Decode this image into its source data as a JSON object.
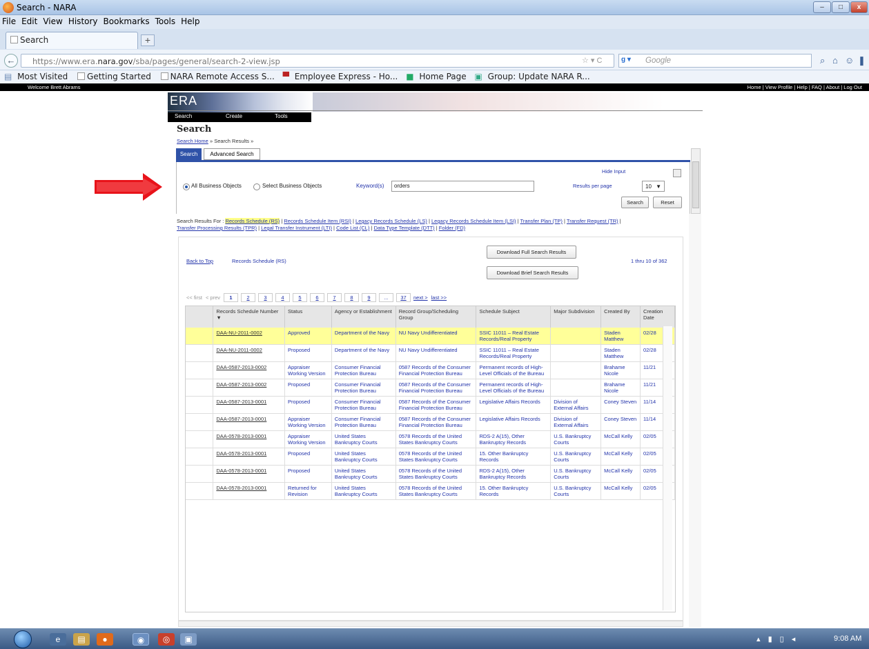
{
  "window": {
    "title": "Search - NARA",
    "min": "–",
    "max": "□",
    "close": "x"
  },
  "menu": [
    "File",
    "Edit",
    "View",
    "History",
    "Bookmarks",
    "Tools",
    "Help"
  ],
  "tab": {
    "label": "Search",
    "new_tab": "+"
  },
  "nav": {
    "url_prefix": "https://www.era.",
    "url_domain": "nara.gov",
    "url_path": "/sba/pages/general/search-2-view.jsp",
    "search_engine": "Google",
    "url_controls": "☆ ▾ C"
  },
  "bookmarks": [
    "Most Visited",
    "Getting Started",
    "NARA Remote Access S...",
    "Employee Express - Ho...",
    "Home Page",
    "Group: Update NARA R..."
  ],
  "header": {
    "welcome": "Welcome Brett Abrams",
    "links": "Home | View Profile | Help | FAQ | About | Log Out",
    "logo": "ERA",
    "menu": [
      "Search",
      "Create",
      "Tools"
    ]
  },
  "page": {
    "title": "Search",
    "crumb_home": "Search Home",
    "crumb_rest": " » Search Results »"
  },
  "search": {
    "tab_search": "Search",
    "tab_advanced": "Advanced Search",
    "all_objects": "All Business Objects",
    "select_objects": "Select Business Objects",
    "keyword_label": "Keyword(s)",
    "keyword_value": "orders",
    "hide_input": "Hide Input",
    "results_per_page_label": "Results per page",
    "results_per_page": "10",
    "search_btn": "Search",
    "reset_btn": "Reset"
  },
  "results_for": {
    "prefix": "Search Results For : ",
    "links": [
      "Records Schedule (RS)",
      "Records Schedule Item (RSI)",
      "Legacy Records Schedule (LS)",
      "Legacy Records Schedule Item (LSI)",
      "Transfer Plan (TP)",
      "Transfer Request (TR)",
      "Transfer Processing Results (TPR)",
      "Legal Transfer Instrument (LTI)",
      "Code List (CL)",
      "Data Type Template (DTT)",
      "Folder (FD)"
    ]
  },
  "results": {
    "back_to_top": "Back to Top",
    "section": "Records Schedule (RS)",
    "download_full": "Download Full Search Results",
    "download_brief": "Download Brief Search Results",
    "range": "1 thru 10 of 362",
    "pager": {
      "first": "<< first",
      "prev": "< prev",
      "pages": [
        "1",
        "2",
        "3",
        "4",
        "5",
        "6",
        "7",
        "8",
        "9",
        "...",
        "37"
      ],
      "next": "next >",
      "last": "last >>"
    }
  },
  "table": {
    "columns": [
      "Records Schedule Number",
      "Status",
      "Agency or Establishment",
      "Record Group/Scheduling Group",
      "Schedule Subject",
      "Major Subdivision",
      "Created By",
      "Creation Date"
    ],
    "rows": [
      [
        "DAA-NU-2011-0002",
        "Approved",
        "Department of the Navy",
        "NU Navy Undifferentiated",
        "SSIC 11011 – Real Estate Records/Real Property",
        "",
        "Staden Matthew",
        "02/28"
      ],
      [
        "DAA-NU-2011-0002",
        "Proposed",
        "Department of the Navy",
        "NU Navy Undifferentiated",
        "SSIC 11011 – Real Estate Records/Real Property",
        "",
        "Staden Matthew",
        "02/28"
      ],
      [
        "DAA-0587-2013-0002",
        "Appraiser Working Version",
        "Consumer Financial Protection Bureau",
        "0587 Records of the Consumer Financial Protection Bureau",
        "Permanent records of High-Level Officials of the Bureau",
        "",
        "Brahame Nicole",
        "11/21"
      ],
      [
        "DAA-0587-2013-0002",
        "Proposed",
        "Consumer Financial Protection Bureau",
        "0587 Records of the Consumer Financial Protection Bureau",
        "Permanent records of High-Level Officials of the Bureau",
        "",
        "Brahame Nicole",
        "11/21"
      ],
      [
        "DAA-0587-2013-0001",
        "Proposed",
        "Consumer Financial Protection Bureau",
        "0587 Records of the Consumer Financial Protection Bureau",
        "Legislative Affairs Records",
        "Division of External Affairs",
        "Coney Steven",
        "11/14"
      ],
      [
        "DAA-0587-2013-0001",
        "Appraiser Working Version",
        "Consumer Financial Protection Bureau",
        "0587 Records of the Consumer Financial Protection Bureau",
        "Legislative Affairs Records",
        "Division of External Affairs",
        "Coney Steven",
        "11/14"
      ],
      [
        "DAA-0578-2013-0001",
        "Appraiser Working Version",
        "United States Bankruptcy Courts",
        "0578 Records of the United States Bankruptcy Courts",
        "RDS-2 A(15), Other Bankruptcy Records",
        "U.S. Bankruptcy Courts",
        "McCall Kelly",
        "02/05"
      ],
      [
        "DAA-0578-2013-0001",
        "Proposed",
        "United States Bankruptcy Courts",
        "0578 Records of the United States Bankruptcy Courts",
        "15. Other Bankruptcy Records",
        "U.S. Bankruptcy Courts",
        "McCall Kelly",
        "02/05"
      ],
      [
        "DAA-0578-2013-0001",
        "Proposed",
        "United States Bankruptcy Courts",
        "0578 Records of the United States Bankruptcy Courts",
        "RDS-2 A(15), Other Bankruptcy Records",
        "U.S. Bankruptcy Courts",
        "McCall Kelly",
        "02/05"
      ],
      [
        "DAA-0578-2013-0001",
        "Returned for Revision",
        "United States Bankruptcy Courts",
        "0578 Records of the United States Bankruptcy Courts",
        "15. Other Bankruptcy Records",
        "U.S. Bankruptcy Courts",
        "McCall Kelly",
        "02/05"
      ]
    ]
  },
  "taskbar": {
    "clock": "9:08 AM"
  },
  "colors": {
    "arrow": "#e8131a",
    "tab_blue": "#2f52a8",
    "highlight": "#ffff99",
    "link": "#2233aa"
  }
}
